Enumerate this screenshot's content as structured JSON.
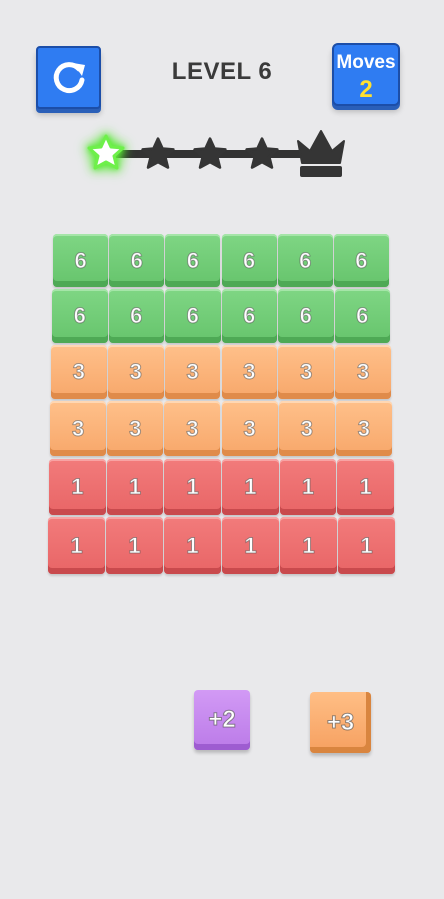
{
  "header": {
    "level_title": "LEVEL 6",
    "moves_label": "Moves",
    "moves_value": "2",
    "restart_icon": "restart-icon"
  },
  "progress": {
    "stars_total": 4,
    "stars_completed": 1,
    "final_icon": "crown-icon",
    "active_color": "#7cf05a"
  },
  "board": {
    "rows": [
      [
        "6",
        "6",
        "6",
        "6",
        "6",
        "6"
      ],
      [
        "6",
        "6",
        "6",
        "6",
        "6",
        "6"
      ],
      [
        "3",
        "3",
        "3",
        "3",
        "3",
        "3"
      ],
      [
        "3",
        "3",
        "3",
        "3",
        "3",
        "3"
      ],
      [
        "1",
        "1",
        "1",
        "1",
        "1",
        "1"
      ],
      [
        "1",
        "1",
        "1",
        "1",
        "1",
        "1"
      ]
    ],
    "row_colors": [
      "green",
      "green",
      "orange",
      "orange",
      "red",
      "red"
    ]
  },
  "pieces": [
    {
      "label": "+2",
      "color": "purple"
    },
    {
      "label": "+3",
      "color": "orange"
    }
  ],
  "colors": {
    "background": "#e9e9eb",
    "button_blue": "#2f7cf2",
    "moves_value": "#ffe030",
    "green": "#70cc76",
    "orange": "#f9b277",
    "red": "#ec6f70",
    "purple": "#c687ee"
  }
}
